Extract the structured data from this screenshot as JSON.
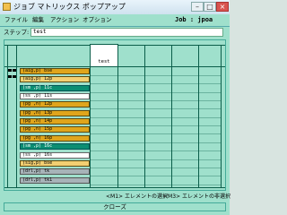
{
  "window": {
    "title": "ジョブ マトリックス ポップアップ"
  },
  "menubar": {
    "items": [
      "ファイル",
      "編集",
      "アクション",
      "オプション"
    ]
  },
  "job": {
    "text": "Job : jpoa"
  },
  "step": {
    "label": "ステップ:",
    "value": "test"
  },
  "grid": {
    "column_header": "test",
    "rows": [
      {
        "label": "(aig,p) bse",
        "style": "orange"
      },
      {
        "label": "(aig,p) 12p",
        "style": "lorange"
      },
      {
        "label": "(sm ,p) 11c",
        "style": "teal"
      },
      {
        "label": "(ss ,p) 11s",
        "style": "white"
      },
      {
        "label": "(pg ,n) 12p",
        "style": "orange"
      },
      {
        "label": "(pg ,n) 13p",
        "style": "orange"
      },
      {
        "label": "(pg ,n) 14p",
        "style": "orange"
      },
      {
        "label": "(pg ,n) 15p",
        "style": "orange"
      },
      {
        "label": "(pg ,n) 16p",
        "style": "orange"
      },
      {
        "label": "(sm ,p) 16c",
        "style": "teal"
      },
      {
        "label": "(ss ,p) 16s",
        "style": "white"
      },
      {
        "label": "(sig,p) bse",
        "style": "lorange"
      },
      {
        "label": "(drl,p) tk",
        "style": "gray"
      },
      {
        "label": "(drl,p) tk1",
        "style": "gray"
      }
    ]
  },
  "status": {
    "left": "<M1> エレメントの選択",
    "right": "<M3> エレメントの非選択"
  },
  "close_label": "クローズ"
}
